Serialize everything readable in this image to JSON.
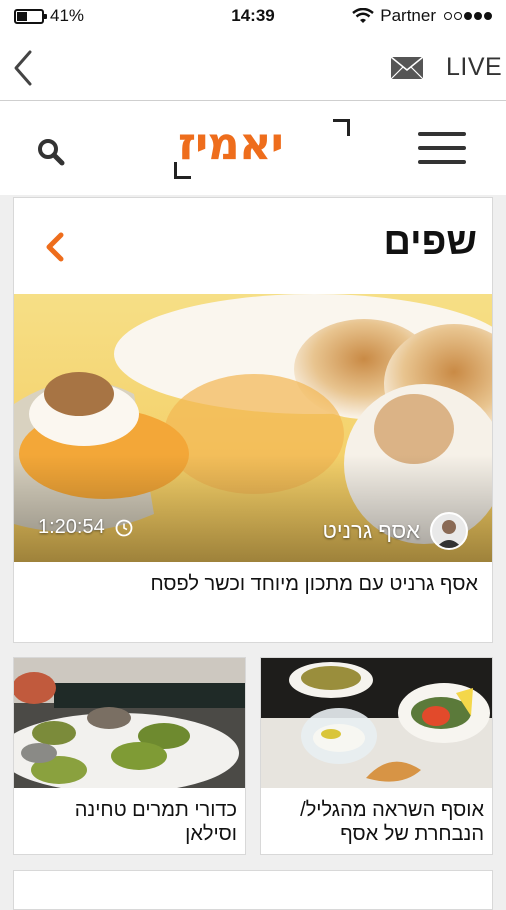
{
  "status": {
    "battery": "41%",
    "battery_level": 0.41,
    "time": "14:39",
    "carrier": "Partner"
  },
  "nav": {
    "live_label": "LIVE"
  },
  "header": {
    "logo_text": "יאמיז"
  },
  "section": {
    "title": "שפים",
    "hero": {
      "author": "אסף גרניט",
      "duration": "1:20:54",
      "caption": "אסף גרניט עם מתכון מיוחד וכשר לפסח"
    },
    "cards": [
      {
        "caption": "אוסף השראה מהגליל/ הנבחרת של אסף"
      },
      {
        "caption": "כדורי תמרים טחינה וסילאן"
      }
    ]
  },
  "colors": {
    "accent": "#ee6d1c",
    "background": "#efefef"
  }
}
